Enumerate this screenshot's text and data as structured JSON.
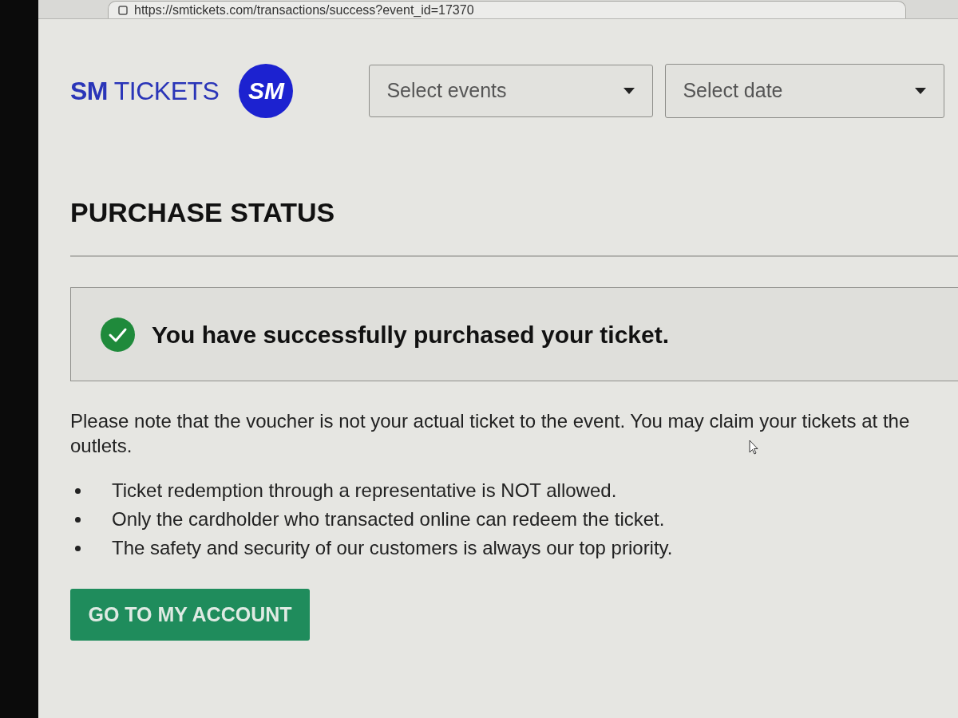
{
  "browser": {
    "url": "https://smtickets.com/transactions/success?event_id=17370"
  },
  "header": {
    "brand": "**SM** TICKETS",
    "brand_mark": "SM",
    "filters": [
      {
        "placeholder": "Select events"
      },
      {
        "placeholder": "Select date"
      }
    ]
  },
  "page": {
    "title": "PURCHASE STATUS",
    "alert": {
      "message": "You have successfully purchased your ticket."
    },
    "note_lines": [
      "Please note that the voucher is not your actual ticket to the event. You may claim your tickets at the",
      "outlets."
    ],
    "rules": [
      "Ticket redemption through a representative is NOT allowed.",
      "Only the cardholder who transacted online can redeem the ticket.",
      "The safety and security of our customers is always our top priority."
    ],
    "button": "GO TO MY ACCOUNT"
  }
}
